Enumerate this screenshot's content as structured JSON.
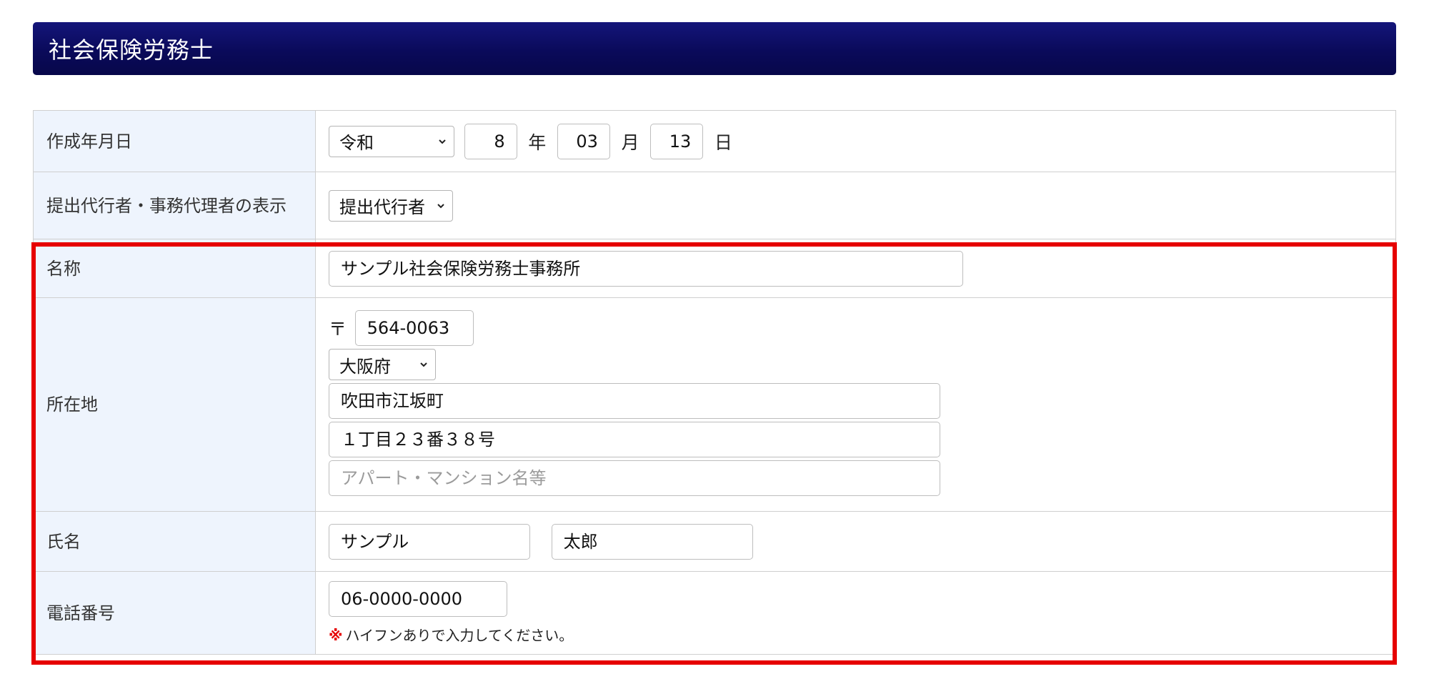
{
  "header": {
    "title": "社会保険労務士"
  },
  "rows": {
    "created_date": {
      "label": "作成年月日",
      "era": "令和",
      "year": "8",
      "year_unit": "年",
      "month": "03",
      "month_unit": "月",
      "day": "13",
      "day_unit": "日"
    },
    "display": {
      "label": "提出代行者・事務代理者の表示",
      "value": "提出代行者"
    },
    "name": {
      "label": "名称",
      "value": "サンプル社会保険労務士事務所"
    },
    "address": {
      "label": "所在地",
      "postal_mark": "〒",
      "postal_code": "564-0063",
      "prefecture": "大阪府",
      "city": "吹田市江坂町",
      "street": "１丁目２３番３８号",
      "building_placeholder": "アパート・マンション名等"
    },
    "person": {
      "label": "氏名",
      "last_name": "サンプル",
      "first_name": "太郎"
    },
    "phone": {
      "label": "電話番号",
      "value": "06-0000-0000",
      "note_mark": "※",
      "note": "ハイフンありで入力してください。"
    }
  },
  "colors": {
    "header_bg": "#0a0a5a",
    "label_bg": "#eef4fd",
    "highlight": "#e60000"
  }
}
